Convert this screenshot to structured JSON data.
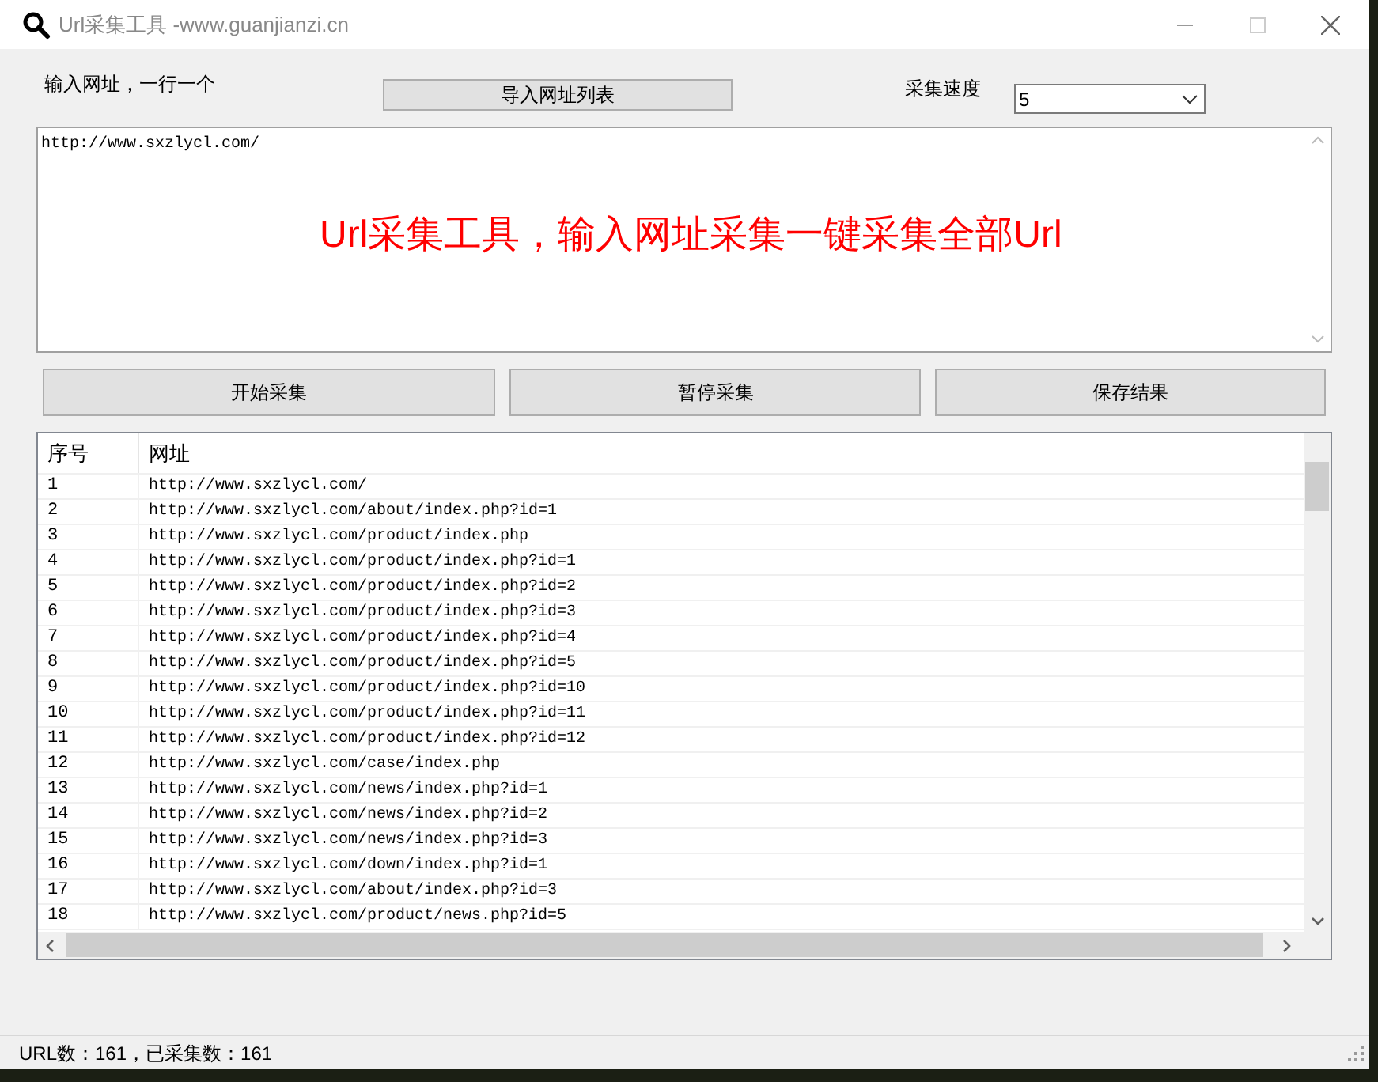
{
  "window": {
    "title": "Url采集工具 -www.guanjianzi.cn"
  },
  "input_label": "输入网址，一行一个",
  "import_button": "导入网址列表",
  "speed": {
    "label": "采集速度",
    "value": "5"
  },
  "url_input": {
    "value": "http://www.sxzlycl.com/",
    "banner": "Url采集工具，输入网址采集一键采集全部Url"
  },
  "buttons": [
    "开始采集",
    "暂停采集",
    "保存结果"
  ],
  "table": {
    "columns": [
      "序号",
      "网址"
    ],
    "rows": [
      [
        "1",
        "http://www.sxzlycl.com/"
      ],
      [
        "2",
        "http://www.sxzlycl.com/about/index.php?id=1"
      ],
      [
        "3",
        "http://www.sxzlycl.com/product/index.php"
      ],
      [
        "4",
        "http://www.sxzlycl.com/product/index.php?id=1"
      ],
      [
        "5",
        "http://www.sxzlycl.com/product/index.php?id=2"
      ],
      [
        "6",
        "http://www.sxzlycl.com/product/index.php?id=3"
      ],
      [
        "7",
        "http://www.sxzlycl.com/product/index.php?id=4"
      ],
      [
        "8",
        "http://www.sxzlycl.com/product/index.php?id=5"
      ],
      [
        "9",
        "http://www.sxzlycl.com/product/index.php?id=10"
      ],
      [
        "10",
        "http://www.sxzlycl.com/product/index.php?id=11"
      ],
      [
        "11",
        "http://www.sxzlycl.com/product/index.php?id=12"
      ],
      [
        "12",
        "http://www.sxzlycl.com/case/index.php"
      ],
      [
        "13",
        "http://www.sxzlycl.com/news/index.php?id=1"
      ],
      [
        "14",
        "http://www.sxzlycl.com/news/index.php?id=2"
      ],
      [
        "15",
        "http://www.sxzlycl.com/news/index.php?id=3"
      ],
      [
        "16",
        "http://www.sxzlycl.com/down/index.php?id=1"
      ],
      [
        "17",
        "http://www.sxzlycl.com/about/index.php?id=3"
      ],
      [
        "18",
        "http://www.sxzlycl.com/product/news.php?id=5"
      ]
    ]
  },
  "status_bar": "URL数：161，已采集数：161"
}
